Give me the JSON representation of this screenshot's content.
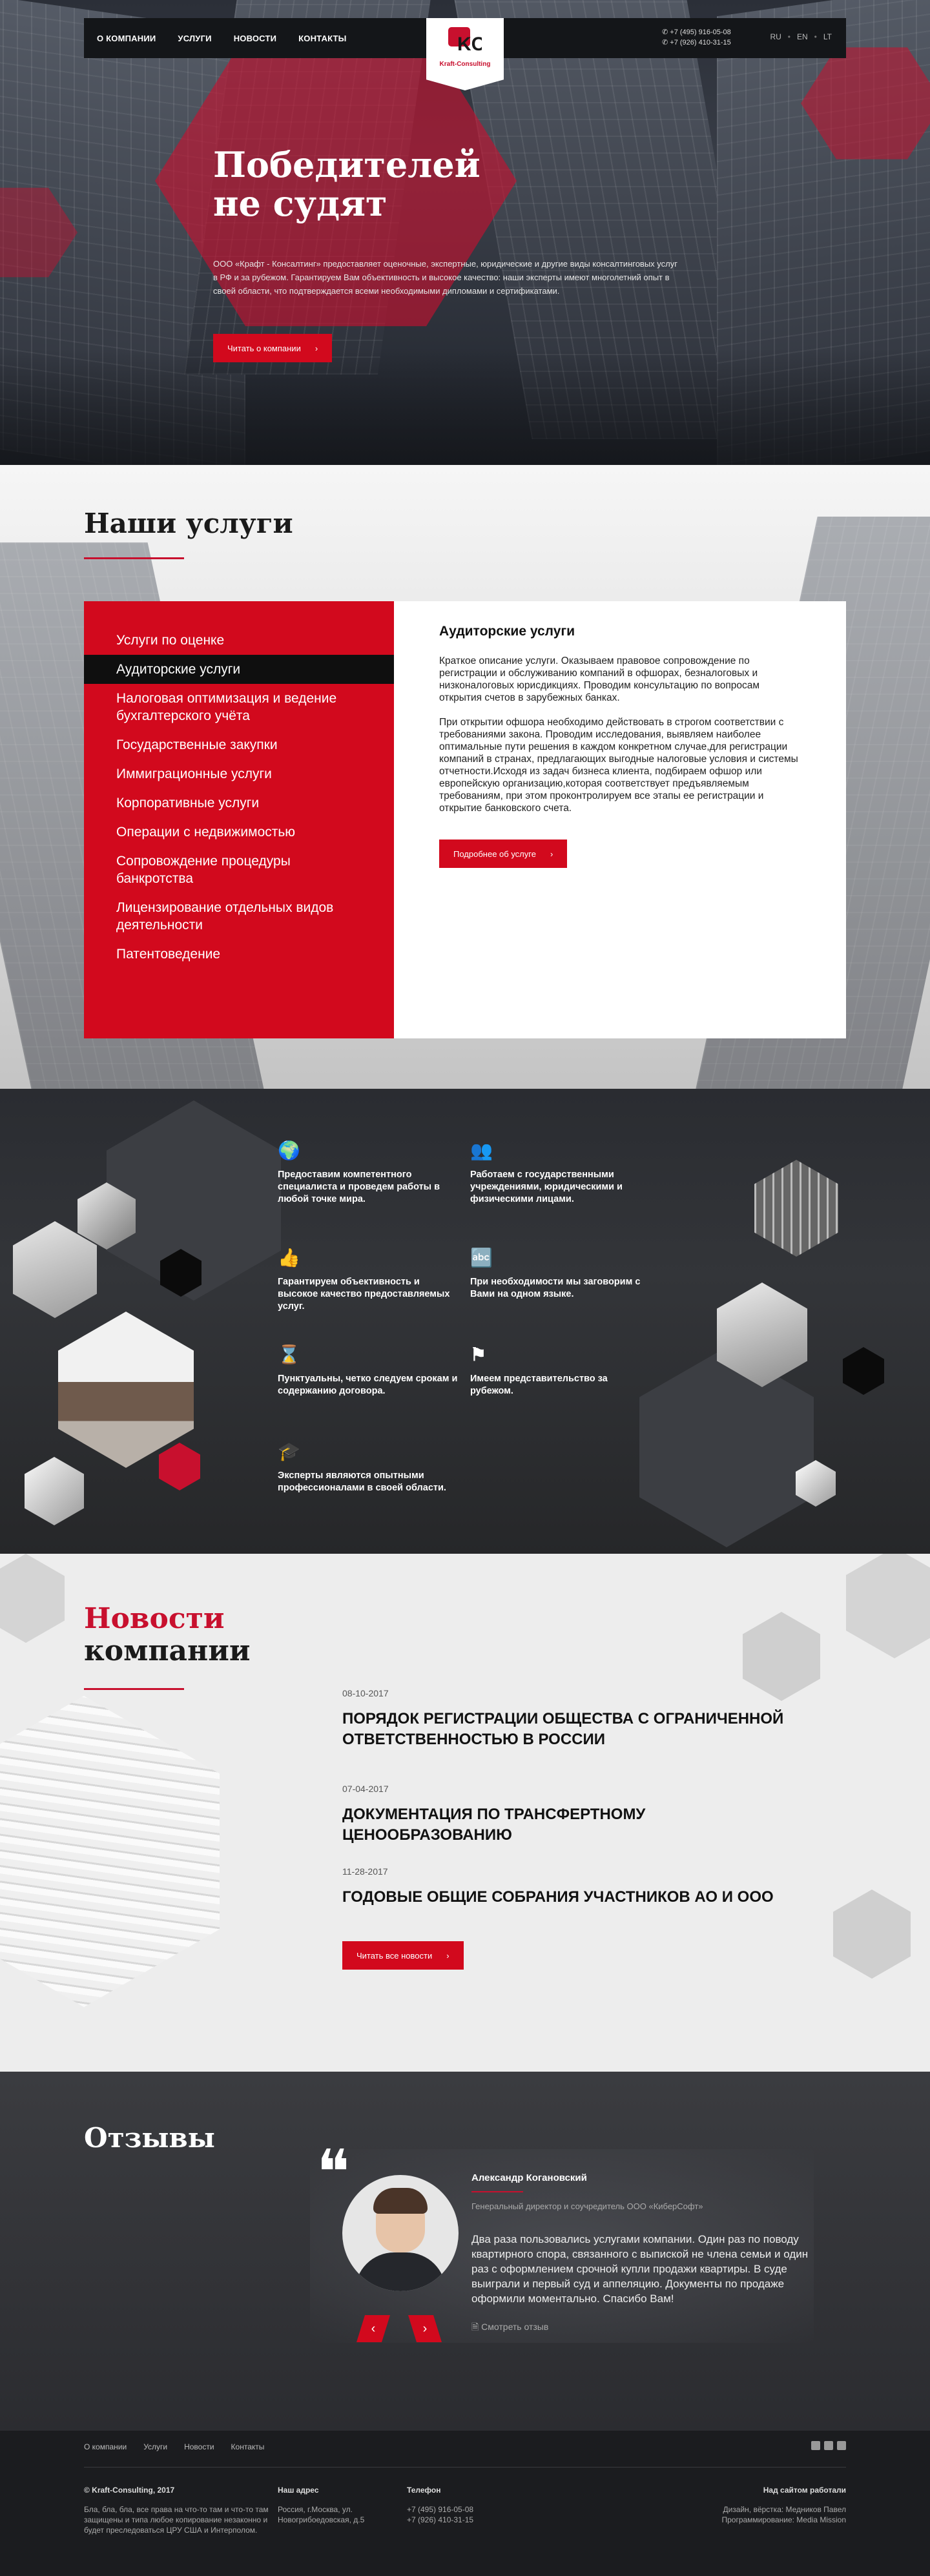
{
  "header": {
    "nav": [
      "О КОМПАНИИ",
      "УСЛУГИ",
      "НОВОСТИ",
      "КОНТАКТЫ"
    ],
    "logo_mark": "KC",
    "logo_text": "Kraft-Consulting",
    "phones": [
      "+7 (495) 916-05-08",
      "+7 (926) 410-31-15"
    ],
    "langs": [
      "RU",
      "EN",
      "LT"
    ]
  },
  "hero": {
    "title_line1": "Победителей",
    "title_line2": "не судят",
    "text": "ООО «Крафт - Консалтинг» предоставляет оценочные, экспертные, юридические и другие виды консалтинговых услуг в РФ и за рубежом. Гарантируем Вам объективность и высокое качество: наши эксперты имеют многолетний опыт в своей области, что подтверждается всеми необходимыми дипломами и сертификатами.",
    "button": "Читать о компании"
  },
  "services": {
    "title": "Наши услуги",
    "items": [
      "Услуги по оценке",
      "Аудиторские услуги",
      "Налоговая оптимизация и ведение бухгалтерского учёта",
      "Государственные закупки",
      "Иммиграционные услуги",
      "Корпоративные услуги",
      "Операции с недвижимостью",
      "Сопровождение процедуры банкротства",
      "Лицензирование отдельных видов деятельности",
      "Патентоведение"
    ],
    "active_index": 1,
    "panel": {
      "title": "Аудиторские услуги",
      "p1": "Краткое описание услуги. Оказываем правовое сопровождение по регистрации и обслуживанию компаний в офшорах, безналоговых и низконалоговых юрисдикциях. Проводим консультацию по вопросам открытия счетов в зарубежных банках.",
      "p2": "При открытии офшора необходимо действовать в строгом соответствии с требованиями закона. Проводим исследования, выявляем наиболее оптимальные пути решения в каждом конкретном случае,для регистрации компаний в странах, предлагающих выгодные налоговые условия и системы отчетности.Исходя из задач бизнеса клиента, подбираем офшор или европейскую организацию,которая соответствует предъявляемым требованиям, при этом проконтролируем все этапы ее регистрации и открытие банковского счета.",
      "button": "Подробнее об услуге"
    }
  },
  "advantages": [
    {
      "icon": "globe-icon",
      "glyph": "🌍",
      "text": "Предоставим компетентного специалиста и проведем работы в любой точке мира."
    },
    {
      "icon": "people-icon",
      "glyph": "👥",
      "text": "Работаем с государственными учреждениями, юридическими и физическими лицами."
    },
    {
      "icon": "thumbs-up-icon",
      "glyph": "👍",
      "text": "Гарантируем объективность и высокое качество предоставляемых услуг."
    },
    {
      "icon": "translate-icon",
      "glyph": "🔤",
      "text": "При необходимости мы заговорим с Вами на одном языке."
    },
    {
      "icon": "hourglass-icon",
      "glyph": "⌛",
      "text": "Пунктуальны, четко следуем срокам и содержанию договора."
    },
    {
      "icon": "flag-icon",
      "glyph": "⚑",
      "text": "Имеем представительство за рубежом."
    },
    {
      "icon": "graduation-cap-icon",
      "glyph": "🎓",
      "text": "Эксперты являются опытными профессионалами в своей области."
    }
  ],
  "news": {
    "title_line1": "Новости",
    "title_line2": "компании",
    "items": [
      {
        "date": "08-10-2017",
        "title": "ПОРЯДОК РЕГИСТРАЦИИ ОБЩЕСТВА С ОГРАНИЧЕННОЙ ОТВЕТСТВЕННОСТЬЮ В РОССИИ"
      },
      {
        "date": "07-04-2017",
        "title": "ДОКУМЕНТАЦИЯ ПО ТРАНСФЕРТНОМУ ЦЕНООБРАЗОВАНИЮ"
      },
      {
        "date": "11-28-2017",
        "title": "ГОДОВЫЕ ОБЩИЕ СОБРАНИЯ УЧАСТНИКОВ АО И ООО"
      }
    ],
    "button": "Читать все новости"
  },
  "reviews": {
    "title": "Отзывы",
    "quote": "❝",
    "name": "Александр Когановский",
    "role": "Генеральный директор и соучредитель ООО «КиберСофт»",
    "text": "Два раза пользовались услугами компании. Один раз по поводу квартирного спора, связанного с выпиской не члена семьи и один раз с оформлением срочной купли продажи квартиры. В суде выиграли и первый суд и аппеляцию. Документы по продаже оформили моментально. Спасибо Вам!",
    "link": "Смотреть отзыв",
    "prev": "‹",
    "next": "›"
  },
  "footer": {
    "nav": [
      "О компании",
      "Услуги",
      "Новости",
      "Контакты"
    ],
    "copyright": "© Kraft-Consulting, 2017",
    "disclaimer": "Бла, бла, бла, все права на что-то там и что-то там защищены и типа любое копирование незаконно и будет преследоваться ЦРУ США и Интерполом.",
    "address_title": "Наш адрес",
    "address": "Россия, г.Москва, ул. Новогрибоедовская, д.5",
    "phone_title": "Телефон",
    "phones": [
      "+7 (495) 916-05-08",
      "+7 (926) 410-31-15"
    ],
    "credits_title": "Над сайтом работали",
    "credits1": "Дизайн, вёрстка: Медников Павел",
    "credits2": "Программирование: Media Mission"
  }
}
